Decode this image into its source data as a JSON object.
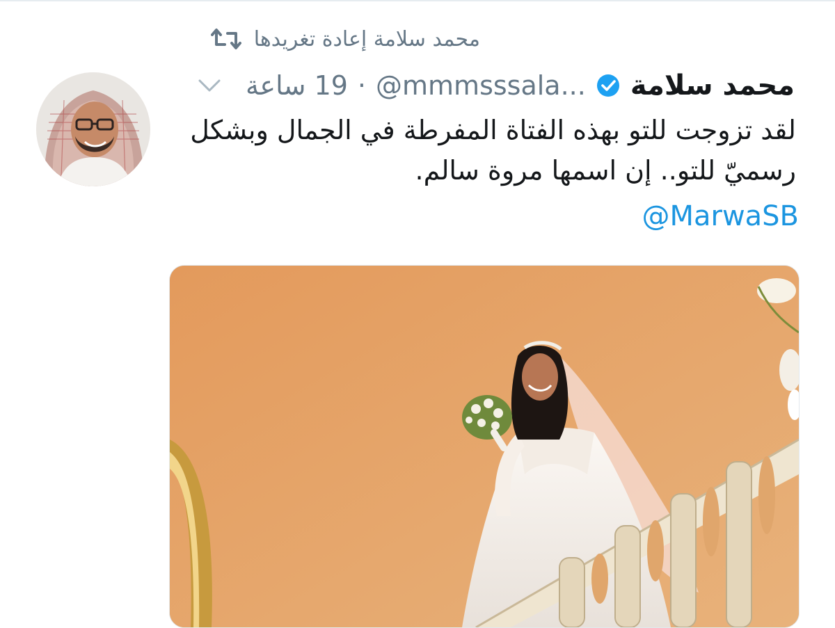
{
  "retweet": {
    "text": "محمد سلامة إعادة تغريدها",
    "icon": "retweet-icon"
  },
  "tweet": {
    "display_name": "محمد سلامة",
    "verified_icon": "verified-badge-icon",
    "handle": "@mmmsssala...",
    "separator": "·",
    "time": "19 ساعة",
    "menu_icon": "chevron-down-icon",
    "text_lines": [
      "لقد تزوجت للتو بهذه الفتاة  المفرطة في الجمال وبشكل",
      "رسميّ للتو.. إن اسمها مروة سالم."
    ],
    "mention": "@MarwaSB",
    "media_alt_icon": "photo"
  },
  "colors": {
    "secondary_text": "#657786",
    "link": "#1b95e0",
    "verified": "#1da1f2",
    "photo_wall": "#e0a56a"
  }
}
